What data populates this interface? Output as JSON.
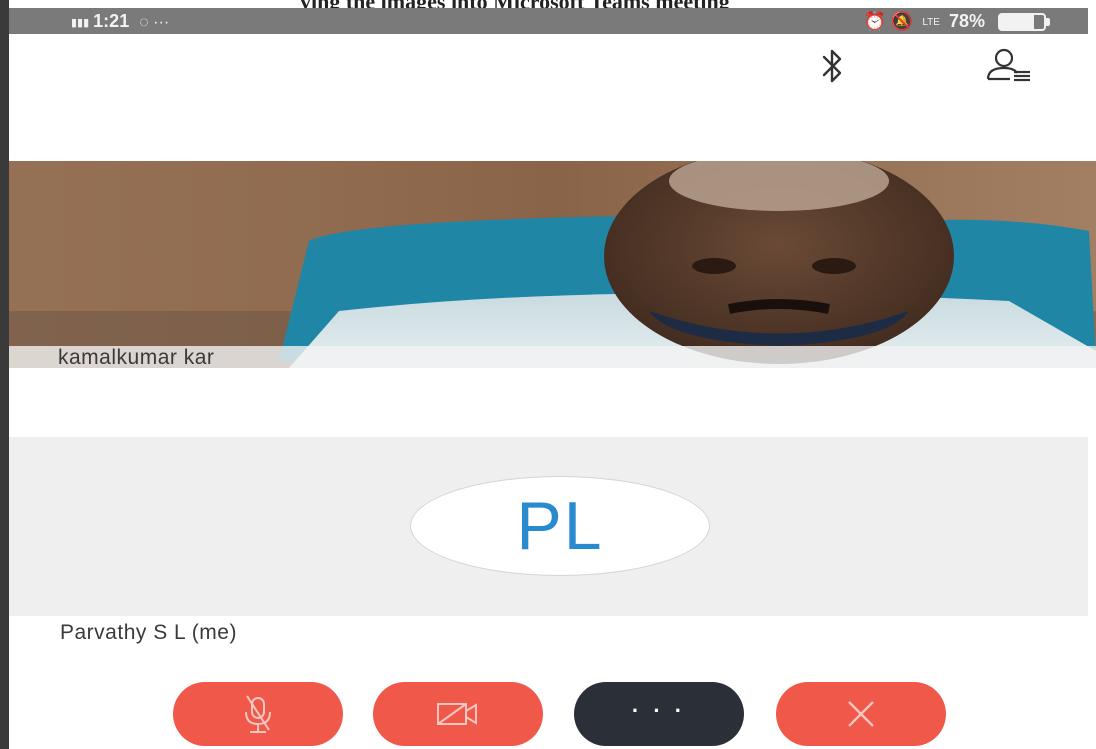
{
  "caption": {
    "text": "ying the images into Microsoft Teams meeting"
  },
  "status_bar": {
    "time": "1:21",
    "battery": "78%",
    "battery_level": 0.78,
    "color": "#7a7a7a"
  },
  "top_icons": {
    "bluetooth": "bluetooth-icon",
    "participants": "participants-icon"
  },
  "remote_participant": {
    "name": "kamalkumar kar"
  },
  "self_participant": {
    "initials": "PL",
    "name": "Parvathy S L (me)",
    "initials_color": "#2a8ad0"
  },
  "controls": {
    "mute": {
      "icon": "mic-off-icon",
      "color": "#f0584a"
    },
    "video": {
      "icon": "video-off-icon",
      "color": "#f0584a"
    },
    "more": {
      "label": "· · ·",
      "color": "#2b3038"
    },
    "end": {
      "icon": "close-icon",
      "color": "#f0584a"
    }
  }
}
